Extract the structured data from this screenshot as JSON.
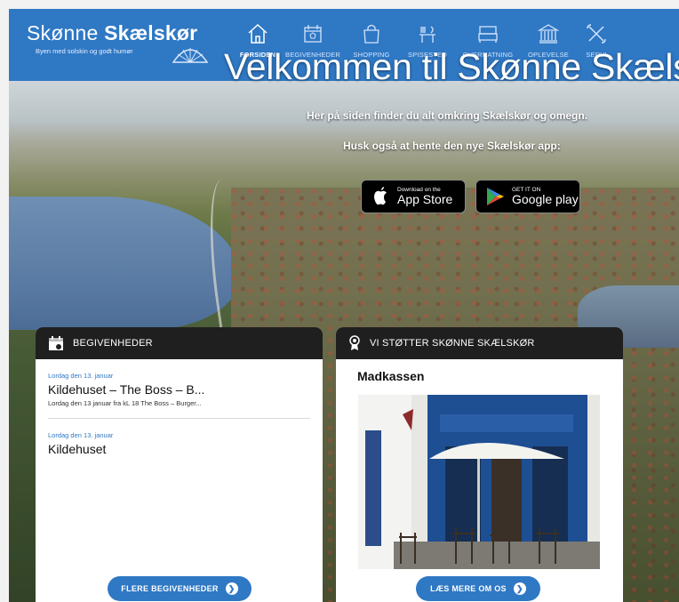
{
  "brand": {
    "name_light": "Skønne",
    "name_bold": "Skælskør",
    "tagline": "Byen med solskin og godt humør"
  },
  "nav": {
    "items": [
      {
        "label": "FORSIDEN",
        "icon": "home-icon",
        "active": true
      },
      {
        "label": "BEGIVENHEDER",
        "icon": "calendar-icon",
        "active": false
      },
      {
        "label": "SHOPPING",
        "icon": "shopping-bag-icon",
        "active": false
      },
      {
        "label": "SPISESTED",
        "icon": "dining-icon",
        "active": false
      },
      {
        "label": "OVERNATNING",
        "icon": "bed-icon",
        "active": false
      },
      {
        "label": "OPLEVELSE",
        "icon": "museum-icon",
        "active": false
      },
      {
        "label": "SERVI",
        "icon": "tools-icon",
        "active": false
      }
    ]
  },
  "hero": {
    "welcome": "Velkommen til Skønne Skæls",
    "intro1": "Her på siden finder du alt omkring Skælskør og omegn.",
    "intro2": "Husk også at hente den nye Skælskør app:"
  },
  "stores": {
    "apple": {
      "small": "Download on the",
      "big": "App Store"
    },
    "google": {
      "small": "GET IT ON",
      "big": "Google play"
    }
  },
  "events_card": {
    "title": "BEGIVENHEDER",
    "events": [
      {
        "date": "Lordag den 13. januar",
        "title": "Kildehuset – The Boss – B...",
        "desc": "Lordag den 13 januar fra kL 18 The Boss – Burger..."
      },
      {
        "date": "Lordag den 13. januar",
        "title": "Kildehuset",
        "desc": ""
      }
    ],
    "button": "FLERE BEGIVENHEDER"
  },
  "support_card": {
    "title": "VI STØTTER SKØNNE SKÆLSKØR",
    "sponsor": "Madkassen",
    "button": "LÆS MERE OM OS"
  },
  "colors": {
    "brand_blue": "#2f78c4",
    "card_header": "#1f1f1f"
  }
}
